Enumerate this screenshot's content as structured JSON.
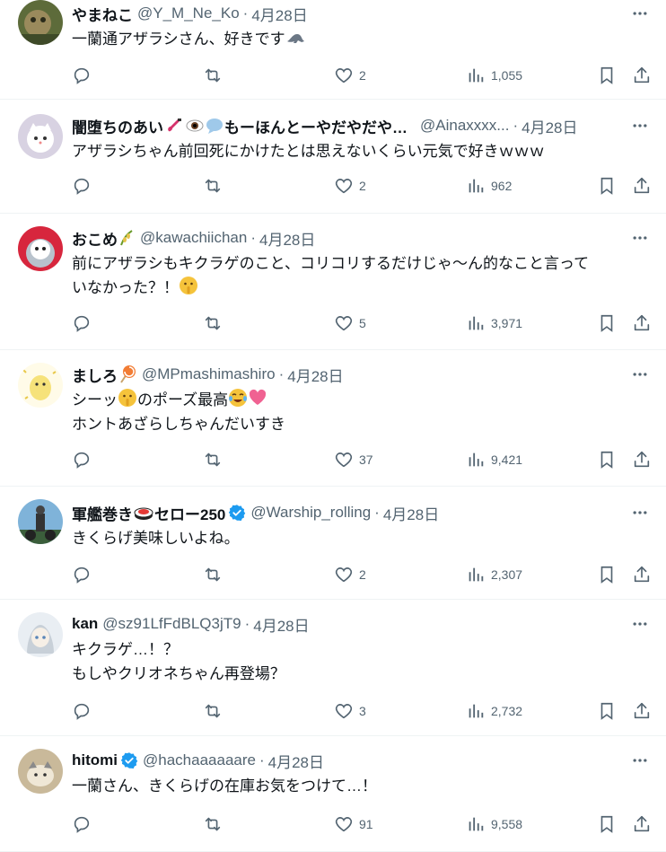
{
  "colors": {
    "text": "#0f1419",
    "muted": "#536471",
    "divider": "#eff3f4",
    "verified": "#1d9bf0"
  },
  "replies": [
    {
      "name": "やまねこ",
      "handle": "@Y_M_Ne_Ko",
      "date": "4月28日",
      "lines": [
        "一蘭通アザラシさん、好きです"
      ],
      "likes": "2",
      "views": "1,055",
      "verified": false
    },
    {
      "name": "闇堕ちのあい",
      "name_suffix": "もーほんとーやだやだや…",
      "handle": "@Ainaxxxx...",
      "date": "4月28日",
      "lines": [
        "アザラシちゃん前回死にかけたとは思えないくらい元気で好きｗｗｗ"
      ],
      "likes": "2",
      "views": "962",
      "verified": false
    },
    {
      "name": "おこめ",
      "handle": "@kawachiichan",
      "date": "4月28日",
      "lines": [
        "前にアザラシもキクラゲのこと、コリコリするだけじゃ～ん的なこと言って",
        "いなかった？！"
      ],
      "likes": "5",
      "views": "3,971",
      "verified": false
    },
    {
      "name": "ましろ",
      "handle": "@MPmashimashiro",
      "date": "4月28日",
      "lines": [
        "シーッ",
        "のポーズ最高",
        "ホントあざらしちゃんだいすき"
      ],
      "likes": "37",
      "views": "9,421",
      "verified": false
    },
    {
      "name": "軍艦巻き",
      "name_suffix": "セロー250",
      "handle": "@Warship_rolling",
      "date": "4月28日",
      "lines": [
        "きくらげ美味しいよね。"
      ],
      "likes": "2",
      "views": "2,307",
      "verified": true
    },
    {
      "name": "kan",
      "handle": "@sz91LfFdBLQ3jT9",
      "date": "4月28日",
      "lines": [
        "キクラゲ…！？",
        "もしやクリオネちゃん再登場？"
      ],
      "likes": "3",
      "views": "2,732",
      "verified": false
    },
    {
      "name": "hitomi",
      "handle": "@hachaaaaaare",
      "date": "4月28日",
      "lines": [
        "一蘭さん、きくらげの在庫お気をつけて…！"
      ],
      "likes": "91",
      "views": "9,558",
      "verified": true
    }
  ]
}
